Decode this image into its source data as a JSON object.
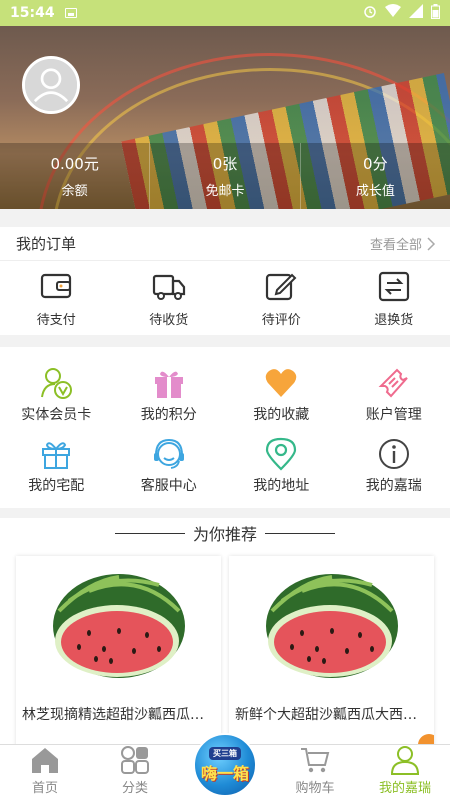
{
  "status_bar": {
    "time": "15:44"
  },
  "profile": {
    "stats": [
      {
        "value": "0.00元",
        "label": "余额"
      },
      {
        "value": "0张",
        "label": "免邮卡"
      },
      {
        "value": "0分",
        "label": "成长值"
      }
    ]
  },
  "orders": {
    "title": "我的订单",
    "view_all": "查看全部",
    "items": [
      {
        "label": "待支付",
        "icon": "wallet-icon"
      },
      {
        "label": "待收货",
        "icon": "truck-icon"
      },
      {
        "label": "待评价",
        "icon": "edit-icon"
      },
      {
        "label": "退换货",
        "icon": "exchange-icon"
      }
    ]
  },
  "services": [
    {
      "label": "实体会员卡",
      "icon": "member-card-icon",
      "color": "#8cbf26"
    },
    {
      "label": "我的积分",
      "icon": "gift-icon",
      "color": "#e38ccb"
    },
    {
      "label": "我的收藏",
      "icon": "heart-icon",
      "color": "#f7a53b"
    },
    {
      "label": "账户管理",
      "icon": "ticket-icon",
      "color": "#ef6b8e"
    },
    {
      "label": "我的宅配",
      "icon": "delivery-box-icon",
      "color": "#3ea6e0"
    },
    {
      "label": "客服中心",
      "icon": "headset-icon",
      "color": "#3ea6e0"
    },
    {
      "label": "我的地址",
      "icon": "location-icon",
      "color": "#35b88a"
    },
    {
      "label": "我的嘉瑞",
      "icon": "info-icon",
      "color": "#444444"
    }
  ],
  "recommend": {
    "title": "为你推荐",
    "products": [
      {
        "name": "林芝现摘精选超甜沙瓤西瓜新鲜水果",
        "image": "watermelon"
      },
      {
        "name": "新鲜个大超甜沙瓤西瓜大西瓜包邮",
        "image": "watermelon"
      }
    ]
  },
  "tabbar": {
    "items": [
      {
        "label": "首页",
        "icon": "home-icon"
      },
      {
        "label": "分类",
        "icon": "category-icon"
      },
      {
        "label": "",
        "icon": "promo-icon",
        "promo_top": "买三箱",
        "promo_main": "嗨一箱"
      },
      {
        "label": "购物车",
        "icon": "cart-icon"
      },
      {
        "label": "我的嘉瑞",
        "icon": "profile-icon"
      }
    ],
    "active_index": 4,
    "active_color": "#8cbf26"
  }
}
